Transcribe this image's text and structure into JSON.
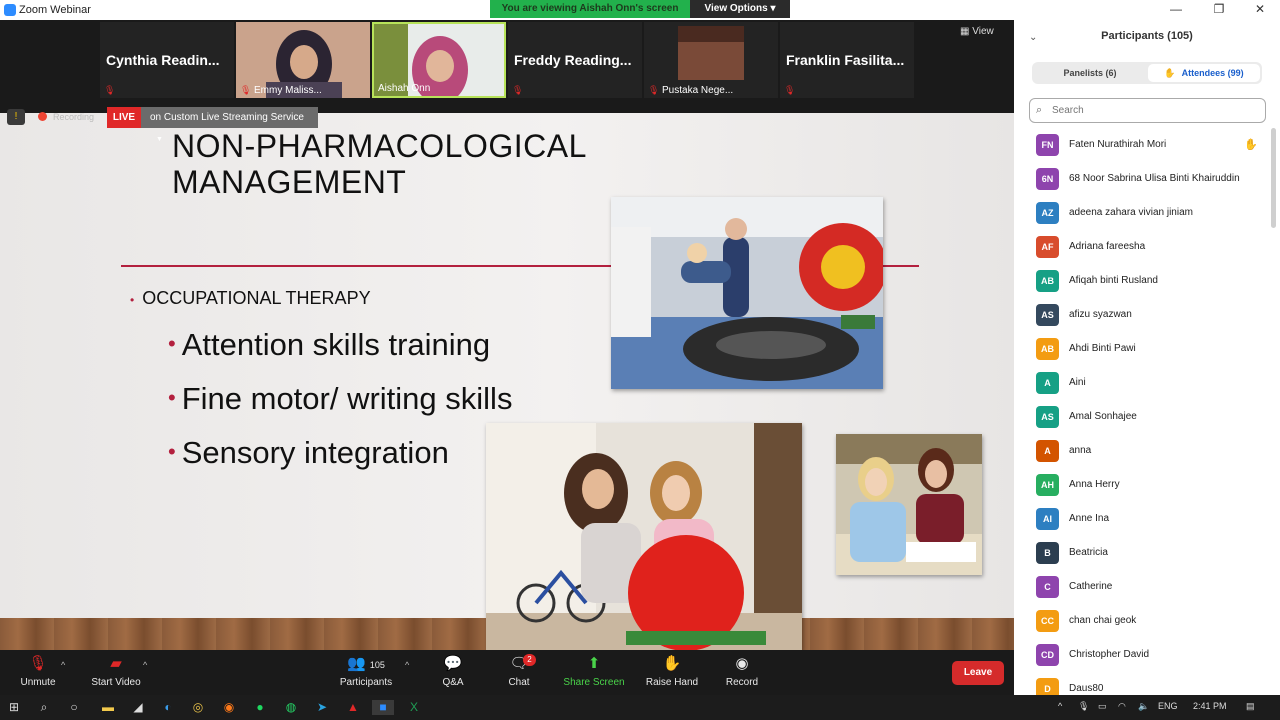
{
  "window": {
    "title": "Zoom Webinar"
  },
  "banner": {
    "viewing": "You are viewing Aishah Onn's screen",
    "view_options": "View Options ▾"
  },
  "strip": {
    "view_label": "View",
    "tiles": [
      {
        "name": "Cynthia  Readin...",
        "type": "name"
      },
      {
        "name": "Emmy Maliss...",
        "type": "video"
      },
      {
        "name": "Aishah Onn",
        "type": "video"
      },
      {
        "name": "Freddy  Reading...",
        "type": "name"
      },
      {
        "name": "Pustaka Nege...",
        "type": "video"
      },
      {
        "name": "Franklin  Fasilita...",
        "type": "name"
      }
    ]
  },
  "recording": {
    "label": "Recording",
    "live": "LIVE",
    "service": "on Custom Live Streaming Service"
  },
  "slide": {
    "title": "NON-PHARMACOLOGICAL MANAGEMENT",
    "bullet": "OCCUPATIONAL THERAPY",
    "subbullets": [
      "Attention skills training",
      "Fine motor/ writing skills",
      "Sensory integration"
    ]
  },
  "toolbar": {
    "unmute": "Unmute",
    "start_video": "Start Video",
    "participants": "Participants",
    "participants_count": "105",
    "qa": "Q&A",
    "chat": "Chat",
    "chat_badge": "2",
    "share_screen": "Share Screen",
    "raise_hand": "Raise Hand",
    "record": "Record",
    "leave": "Leave"
  },
  "panel": {
    "title": "Participants (105)",
    "tab_panelists": "Panelists (6)",
    "tab_attendees": "Attendees (99)",
    "search_placeholder": "Search",
    "participants": [
      {
        "initials": "FN",
        "name": "Faten Nurathirah Mori",
        "color": "#8e44ad",
        "hand": true
      },
      {
        "initials": "6N",
        "name": "68 Noor Sabrina Ulisa Binti Khairuddin",
        "color": "#8e44ad",
        "hand": false
      },
      {
        "initials": "AZ",
        "name": "adeena zahara vivian jiniam",
        "color": "#2d7fc1",
        "hand": false
      },
      {
        "initials": "AF",
        "name": "Adriana fareesha",
        "color": "#d84c2c",
        "hand": false
      },
      {
        "initials": "AB",
        "name": "Afiqah binti Rusland",
        "color": "#16a085",
        "hand": false
      },
      {
        "initials": "AS",
        "name": "afizu syazwan",
        "color": "#34495e",
        "hand": false
      },
      {
        "initials": "AB",
        "name": "Ahdi Binti Pawi",
        "color": "#f39c12",
        "hand": false
      },
      {
        "initials": "A",
        "name": "Aini",
        "color": "#16a085",
        "hand": false
      },
      {
        "initials": "AS",
        "name": "Amal Sonhajee",
        "color": "#16a085",
        "hand": false
      },
      {
        "initials": "A",
        "name": "anna",
        "color": "#d35400",
        "hand": false
      },
      {
        "initials": "AH",
        "name": "Anna Herry",
        "color": "#27ae60",
        "hand": false
      },
      {
        "initials": "AI",
        "name": "Anne Ina",
        "color": "#2d7fc1",
        "hand": false
      },
      {
        "initials": "B",
        "name": "Beatricia",
        "color": "#2c3e50",
        "hand": false
      },
      {
        "initials": "C",
        "name": "Catherine",
        "color": "#8e44ad",
        "hand": false
      },
      {
        "initials": "CC",
        "name": "chan chai geok",
        "color": "#f39c12",
        "hand": false
      },
      {
        "initials": "CD",
        "name": "Christopher David",
        "color": "#8e44ad",
        "hand": false
      },
      {
        "initials": "D",
        "name": "Daus80",
        "color": "#f39c12",
        "hand": false
      }
    ]
  },
  "taskbar": {
    "lang": "ENG",
    "time": "2:41 PM"
  }
}
